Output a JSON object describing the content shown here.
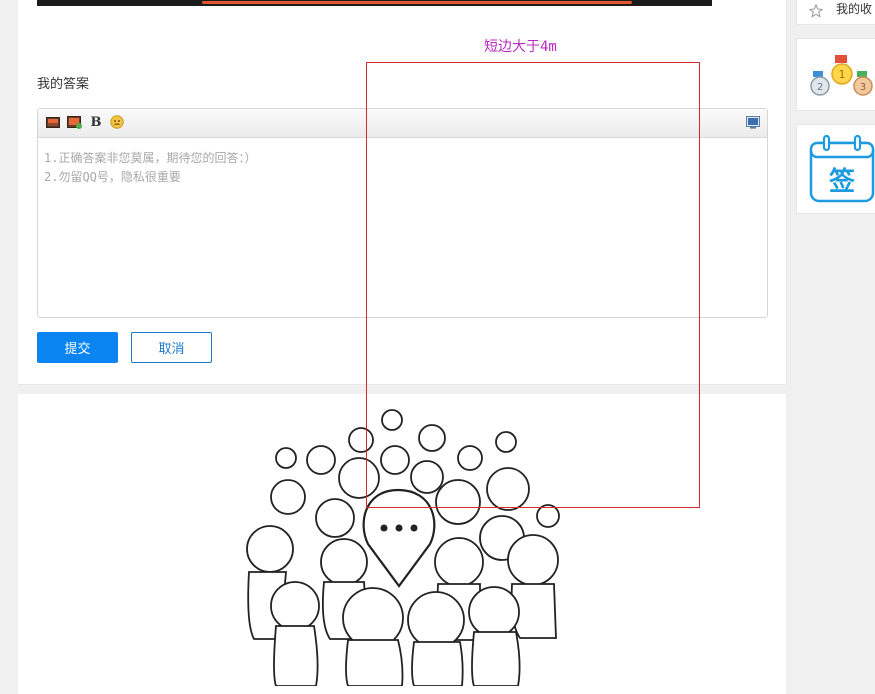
{
  "annotation": {
    "label": "短边大于4m"
  },
  "answer": {
    "title": "我的答案",
    "placeholder_lines": [
      "1.正确答案非您莫属，期待您的回答：）",
      "2.勿留QQ号，隐私很重要"
    ]
  },
  "toolbar": {
    "items": [
      "image-icon",
      "photo-icon",
      "bold",
      "emoji-icon",
      "fullscreen-icon"
    ],
    "bold_label": "B"
  },
  "actions": {
    "submit_label": "提交",
    "cancel_label": "取消"
  },
  "sidebar": {
    "favorites_label": "我的收",
    "ranking": {
      "medals": [
        "2",
        "1",
        "3"
      ]
    },
    "signin_label": "签"
  },
  "colors": {
    "primary": "#0a84f0",
    "annotation_box": "#d82a2a",
    "annotation_text": "#b829c0",
    "signin_blue": "#1e9be0"
  }
}
